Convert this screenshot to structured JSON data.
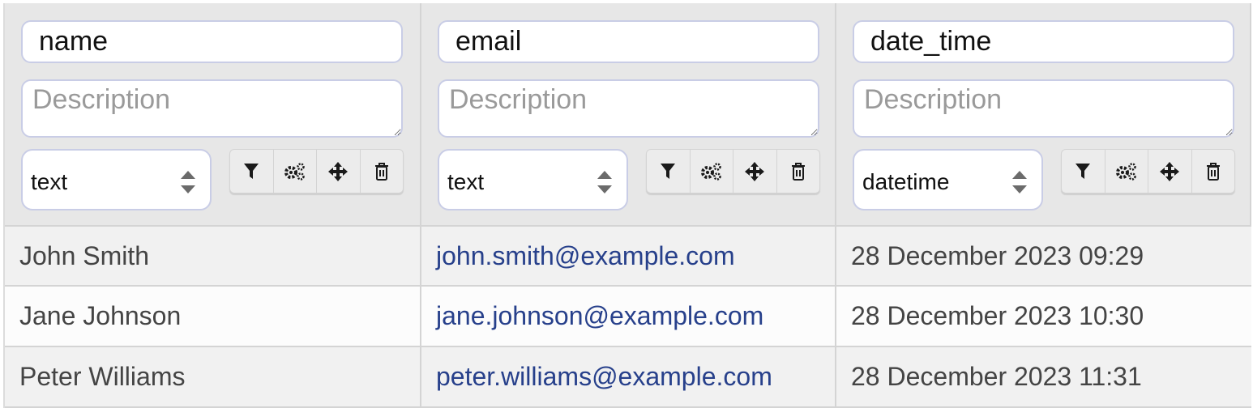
{
  "columns": [
    {
      "name": "name",
      "description_placeholder": "Description",
      "type": "text",
      "buttons": [
        "filter-icon",
        "gears-icon",
        "move-icon",
        "trash-icon"
      ]
    },
    {
      "name": "email",
      "description_placeholder": "Description",
      "type": "text",
      "buttons": [
        "filter-icon",
        "gears-icon",
        "move-icon",
        "trash-icon"
      ]
    },
    {
      "name": "date_time",
      "description_placeholder": "Description",
      "type": "datetime",
      "buttons": [
        "filter-icon",
        "gears-icon",
        "move-icon",
        "trash-icon"
      ]
    }
  ],
  "rows": [
    {
      "name": "John Smith",
      "email": "john.smith@example.com",
      "date_time": "28 December 2023 09:29"
    },
    {
      "name": "Jane Johnson",
      "email": "jane.johnson@example.com",
      "date_time": "28 December 2023 10:30"
    },
    {
      "name": "Peter Williams",
      "email": "peter.williams@example.com",
      "date_time": "28 December 2023 11:31"
    }
  ],
  "colors": {
    "header_bg": "#e7e7e7",
    "border": "#d4d4d4",
    "input_border": "#c9cde6",
    "link": "#27408b",
    "text": "#444444"
  }
}
